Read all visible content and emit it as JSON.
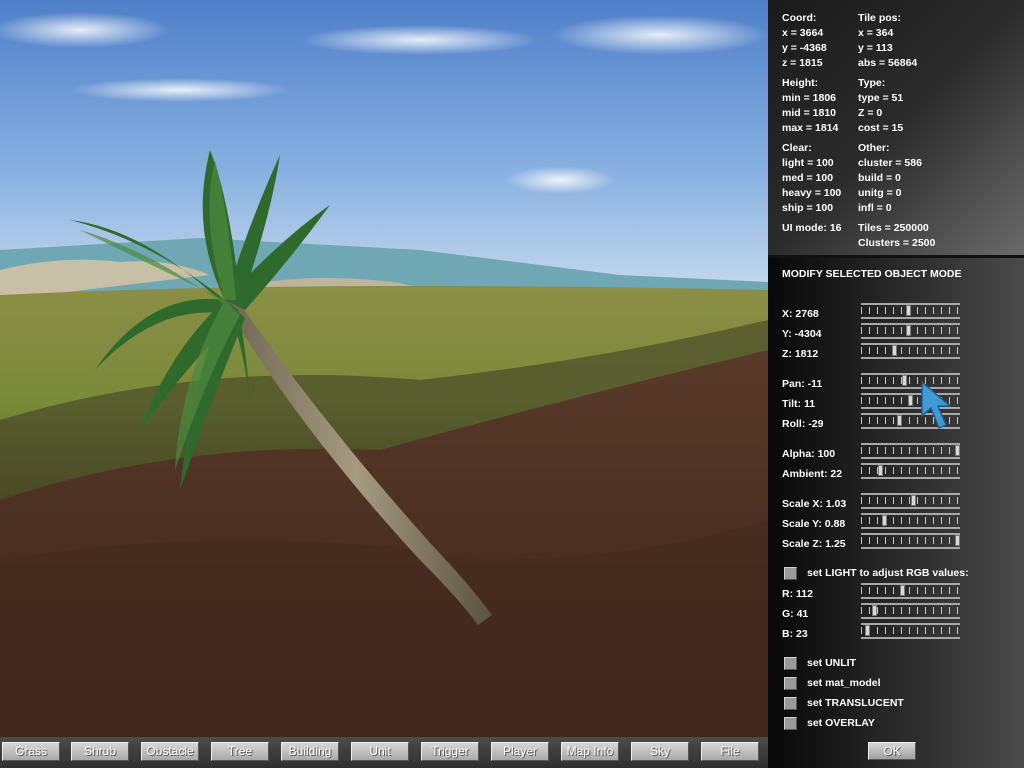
{
  "toolbar": {
    "buttons": [
      "Grass",
      "Shrub",
      "Obstacle",
      "Tree",
      "Building",
      "Unit",
      "Trigger",
      "Player",
      "Map Info",
      "Sky",
      "File"
    ]
  },
  "info": {
    "coord": {
      "title": "Coord:",
      "x": "x = 3664",
      "y": "y = -4368",
      "z": "z = 1815"
    },
    "tile": {
      "title": "Tile pos:",
      "x": "x = 364",
      "y": "y = 113",
      "abs": "abs = 56864"
    },
    "height": {
      "title": "Height:",
      "min": "min = 1806",
      "mid": "mid = 1810",
      "max": "max = 1814"
    },
    "type": {
      "title": "Type:",
      "type": "type = 51",
      "z": "Z = 0",
      "cost": "cost = 15"
    },
    "clear": {
      "title": "Clear:",
      "light": "light = 100",
      "med": "med = 100",
      "heavy": "heavy = 100",
      "ship": "ship = 100"
    },
    "other": {
      "title": "Other:",
      "cluster": "cluster = 586",
      "build": "build = 0",
      "unitg": "unitg = 0",
      "infl": "infl = 0"
    },
    "ui_mode": "UI mode: 16",
    "tiles": "Tiles = 250000",
    "clusters": "Clusters = 2500"
  },
  "mode_title": "MODIFY SELECTED OBJECT MODE",
  "sliders": {
    "x": {
      "label": "X: 2768",
      "fraction": 0.48
    },
    "y": {
      "label": "Y: -4304",
      "fraction": 0.48
    },
    "z": {
      "label": "Z: 1812",
      "fraction": 0.33
    },
    "pan": {
      "label": "Pan: -11",
      "fraction": 0.44
    },
    "tilt": {
      "label": "Tilt: 11",
      "fraction": 0.5
    },
    "roll": {
      "label": "Roll: -29",
      "fraction": 0.38
    },
    "alpha": {
      "label": "Alpha: 100",
      "fraction": 1.0
    },
    "ambient": {
      "label": "Ambient: 22",
      "fraction": 0.18
    },
    "scale_x": {
      "label": "Scale X: 1.03",
      "fraction": 0.53
    },
    "scale_y": {
      "label": "Scale Y: 0.88",
      "fraction": 0.22
    },
    "scale_z": {
      "label": "Scale Z: 1.25",
      "fraction": 1.0
    },
    "r": {
      "label": "R: 112",
      "fraction": 0.42
    },
    "g": {
      "label": "G: 41",
      "fraction": 0.12
    },
    "b": {
      "label": "B: 23",
      "fraction": 0.04
    }
  },
  "checks": {
    "light_rgb": "set LIGHT to adjust RGB values:",
    "unlit": "set UNLIT",
    "mat_model": "set mat_model",
    "translucent": "set TRANSLUCENT",
    "overlay": "set OVERLAY"
  },
  "ok_label": "OK"
}
